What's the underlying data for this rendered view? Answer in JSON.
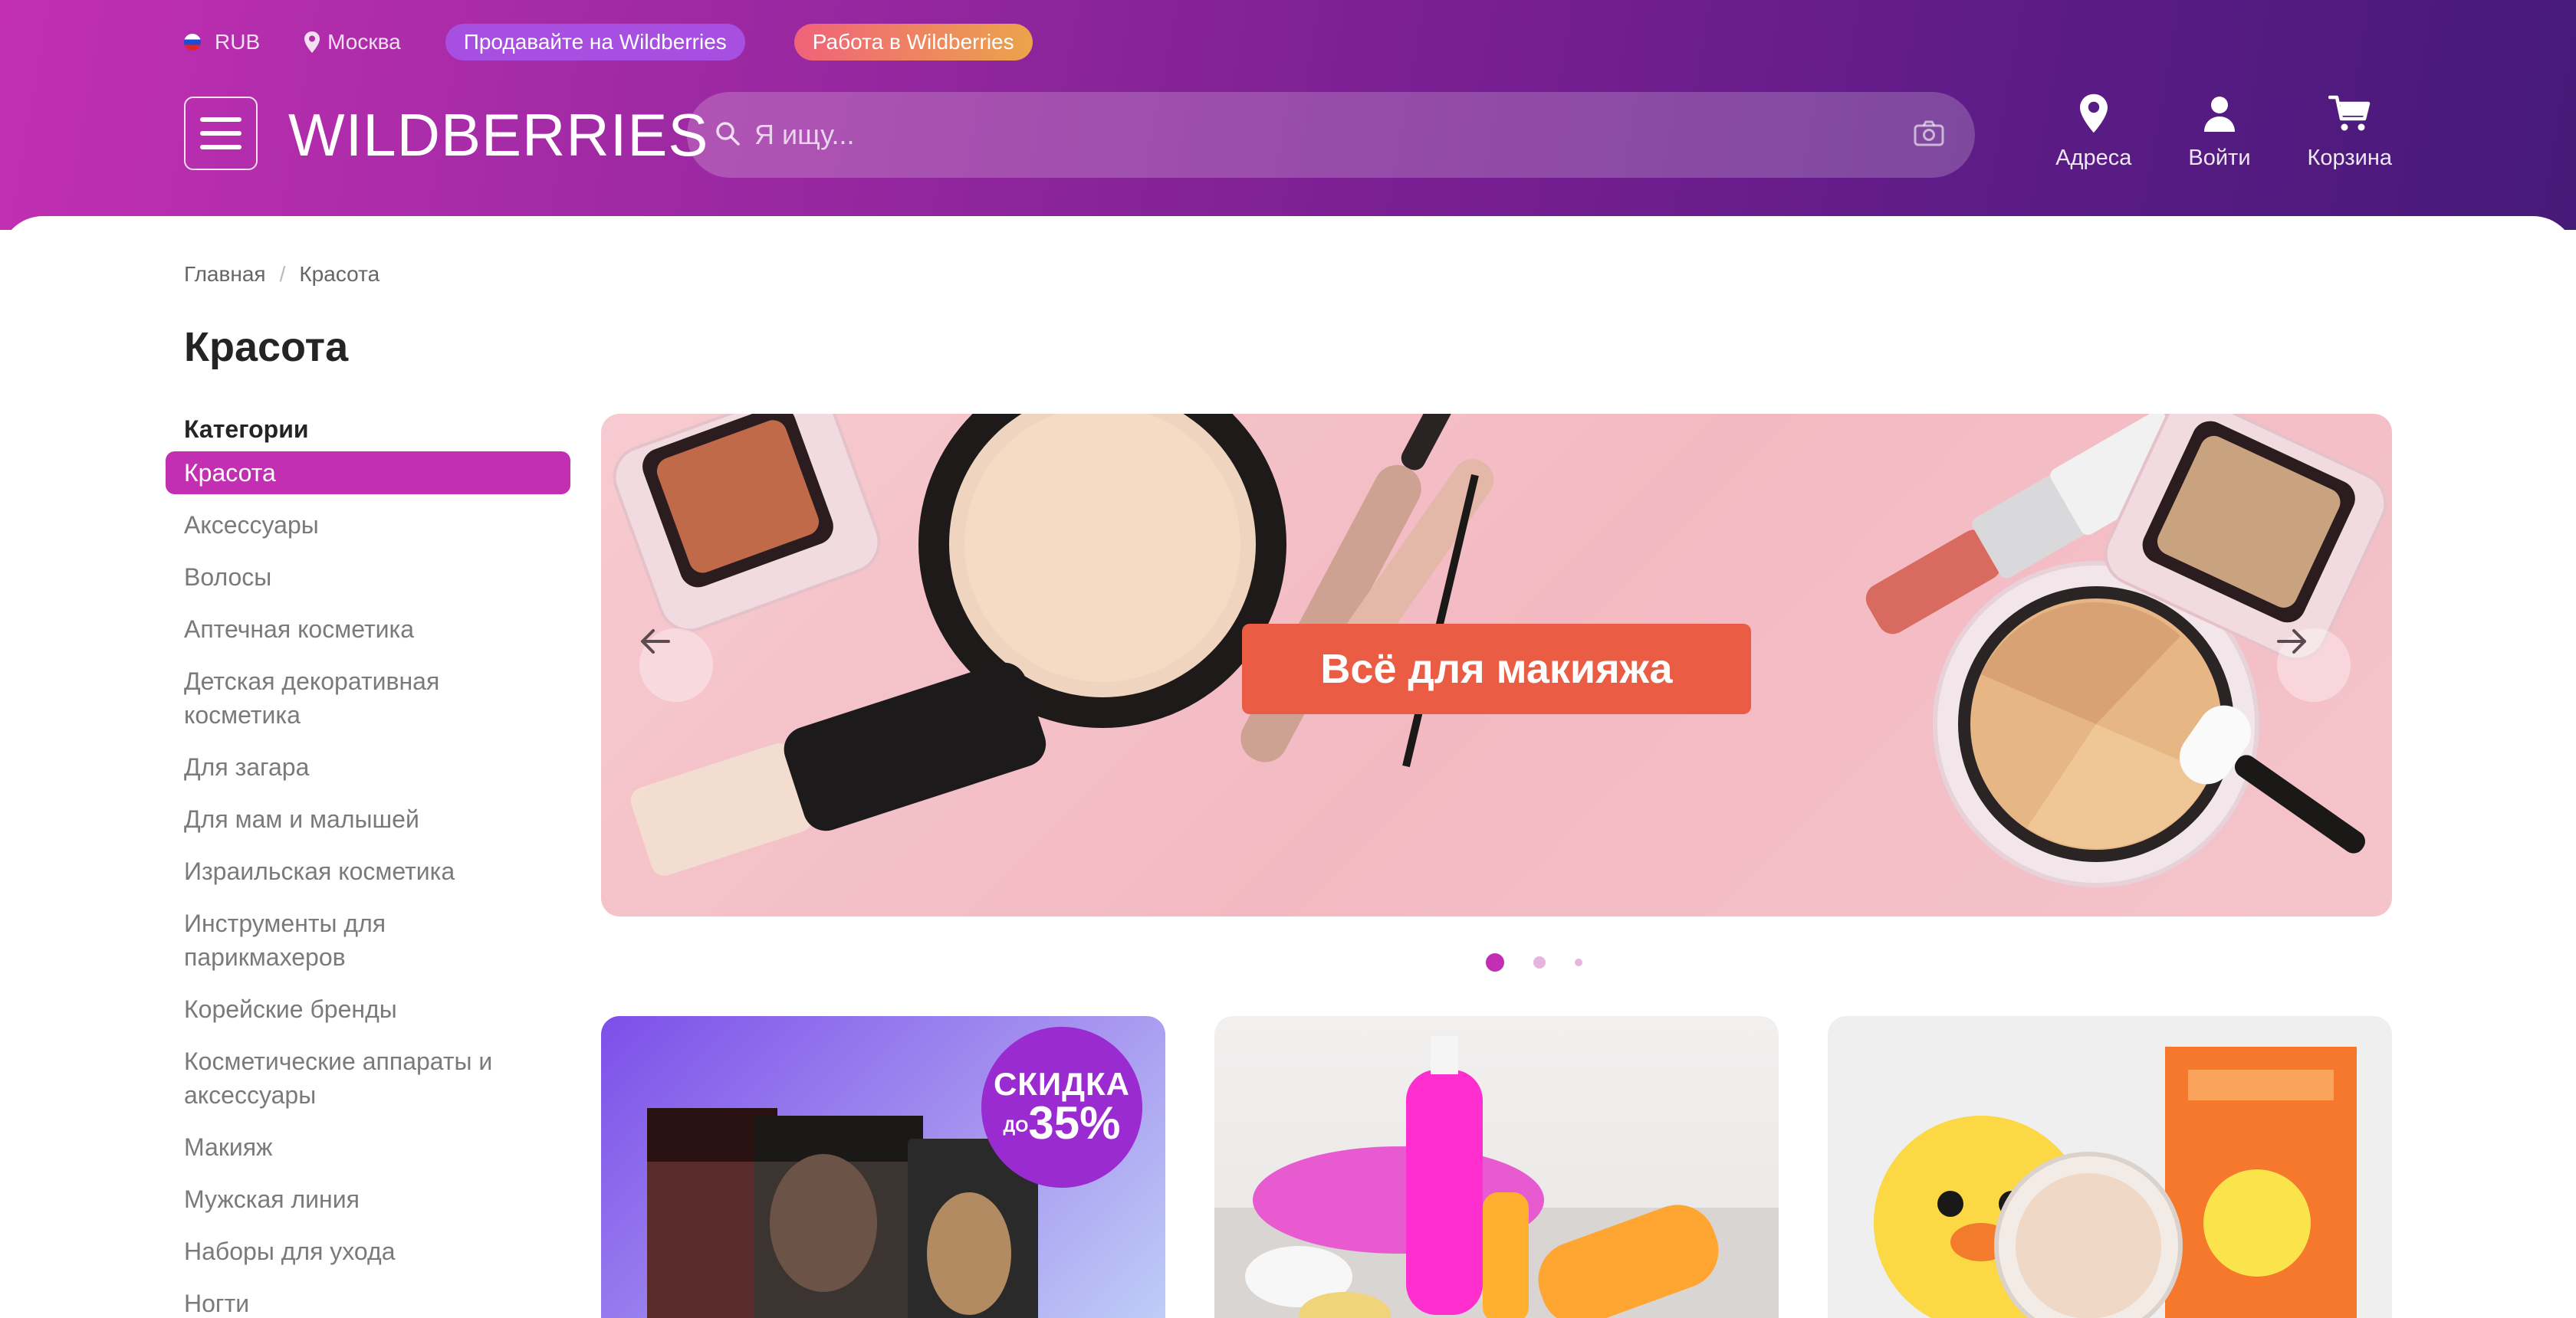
{
  "topbar": {
    "currency": "RUB",
    "city": "Москва",
    "sell_label": "Продавайте на Wildberries",
    "job_label": "Работа в Wildberries"
  },
  "header": {
    "logo": "WILDBERRIES",
    "search_placeholder": "Я ищу...",
    "actions": {
      "addresses": "Адреса",
      "login": "Войти",
      "cart": "Корзина"
    }
  },
  "breadcrumb": {
    "home": "Главная",
    "separator": "/",
    "current": "Красота"
  },
  "page_title": "Красота",
  "sidebar": {
    "heading": "Категории",
    "items": [
      "Красота",
      "Аксессуары",
      "Волосы",
      "Аптечная косметика",
      "Детская декоративная косметика",
      "Для загара",
      "Для мам и малышей",
      "Израильская косметика",
      "Инструменты для парикмахеров",
      "Корейские бренды",
      "Косметические аппараты и аксессуары",
      "Макияж",
      "Мужская линия",
      "Наборы для ухода",
      "Ногти"
    ],
    "active_index": 0
  },
  "banner": {
    "cta": "Всё для макияжа",
    "slides": 3,
    "active_slide": 0
  },
  "cards": [
    {
      "promo_line1": "СКИДКА",
      "promo_prefix": "ДО",
      "promo_value": "35%"
    },
    {},
    {}
  ],
  "colors": {
    "accent": "#c22fb2",
    "cta": "#ea5c43",
    "header_start": "#c22fb2",
    "header_end": "#461a78"
  }
}
